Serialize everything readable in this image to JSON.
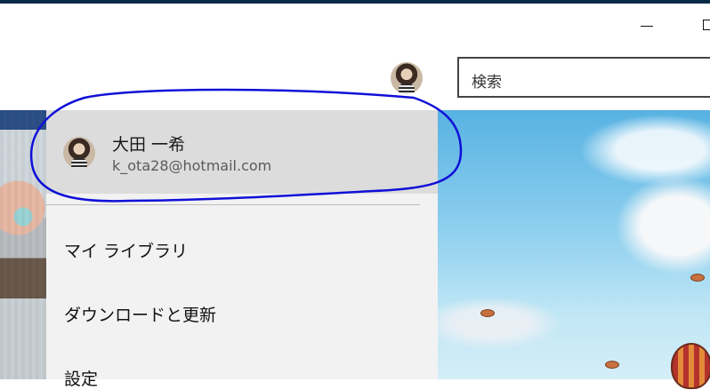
{
  "window": {
    "minimize_icon": "minimize-icon",
    "maximize_icon": "maximize-icon"
  },
  "header": {
    "avatar_icon": "user-avatar-icon",
    "search": {
      "placeholder": "検索"
    }
  },
  "account_menu": {
    "user": {
      "name": "大田 一希",
      "email": "k_ota28@hotmail.com"
    },
    "items": [
      {
        "label": "マイ ライブラリ"
      },
      {
        "label": "ダウンロードと更新"
      },
      {
        "label": "設定"
      }
    ]
  },
  "annotation": {
    "color": "#1010d8"
  },
  "colors": {
    "menu_background": "#f2f2f2",
    "account_card_background": "#dcdcdc",
    "title_bar_accent": "#0b2a47"
  }
}
